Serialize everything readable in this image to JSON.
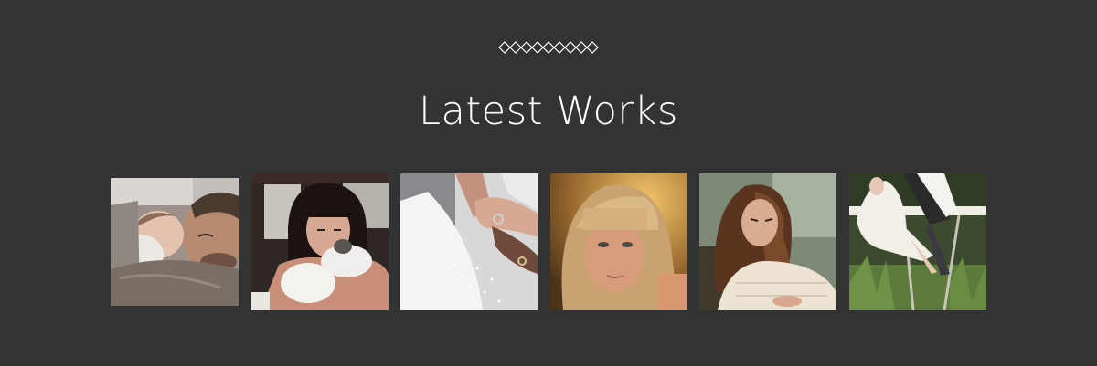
{
  "section": {
    "title": "Latest Works",
    "divider_icon": "diamond-row-ornament"
  },
  "gallery": {
    "items": [
      {
        "icon": "photo-father-baby"
      },
      {
        "icon": "photo-woman-cat"
      },
      {
        "icon": "photo-wedding-hands"
      },
      {
        "icon": "photo-girl-portrait"
      },
      {
        "icon": "photo-woman-long-hair"
      },
      {
        "icon": "photo-woman-white-dress"
      }
    ]
  },
  "colors": {
    "background": "#333333",
    "title": "#ffffff",
    "ornament": "#ffffff"
  }
}
